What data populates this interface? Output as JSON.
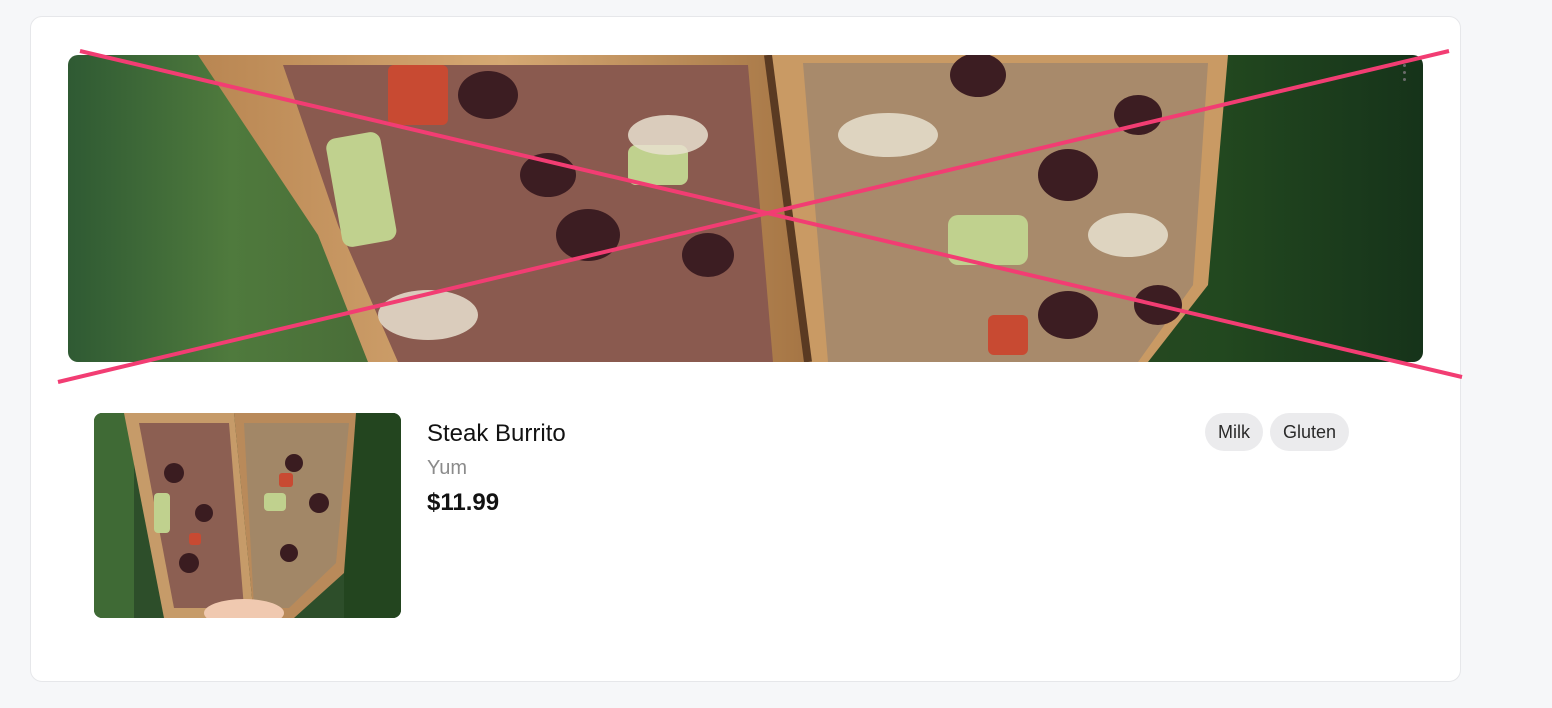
{
  "item": {
    "name": "Steak Burrito",
    "description": "Yum",
    "price": "$11.99",
    "allergens": [
      "Milk",
      "Gluten"
    ]
  },
  "images": {
    "hero_icon": "food-photo-icon",
    "thumbnail_icon": "food-photo-icon"
  },
  "overlay": {
    "icon": "placeholder-cross-icon",
    "color": "#f23d73"
  },
  "colors": {
    "page_background": "#f6f7f9",
    "card_background": "#ffffff",
    "tag_background": "#ebebed",
    "price_text": "#121212",
    "muted_text": "#8b8b8b"
  }
}
